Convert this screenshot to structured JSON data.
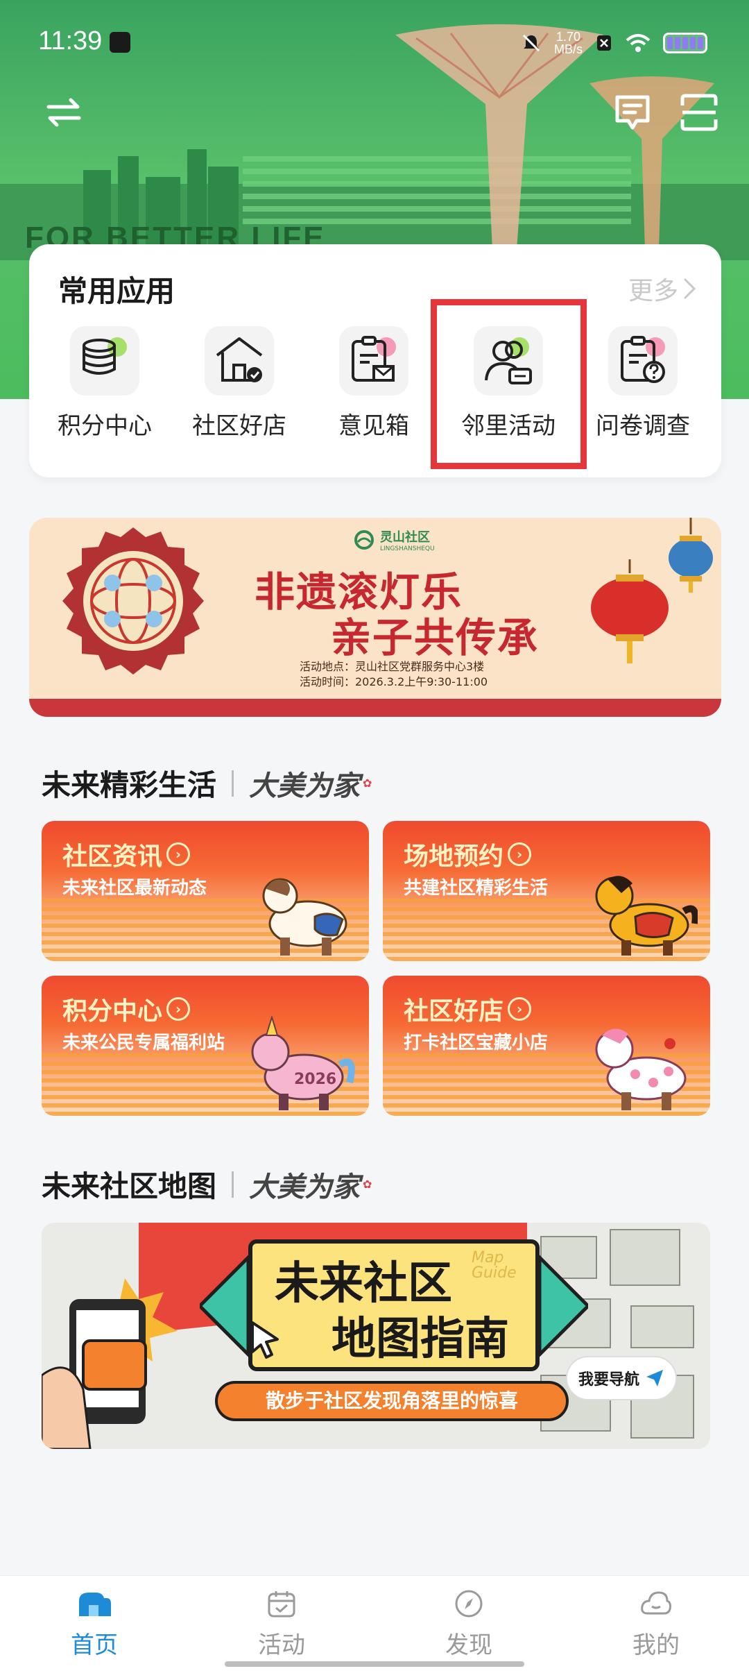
{
  "status_bar": {
    "time": "11:39",
    "net_speed_value": "1.70",
    "net_speed_unit": "MB/s"
  },
  "hero": {
    "slogan": "FOR BETTER LIFE"
  },
  "apps": {
    "title": "常用应用",
    "more": "更多",
    "items": [
      {
        "label": "积分中心",
        "icon": "coins-stack-icon",
        "accent": "#a6e06b"
      },
      {
        "label": "社区好店",
        "icon": "store-house-icon",
        "accent": "#8ec9f5"
      },
      {
        "label": "意见箱",
        "icon": "clipboard-mail-icon",
        "accent": "#f59ab7"
      },
      {
        "label": "邻里活动",
        "icon": "people-chat-icon",
        "accent": "#a6e06b"
      },
      {
        "label": "问卷调查",
        "icon": "clipboard-question-icon",
        "accent": "#f59ab7"
      }
    ]
  },
  "promo": {
    "logo": "灵山社区",
    "logo_sub": "LINGSHANSHEQU",
    "title_line1": "非遗滚灯乐",
    "title_line2": "亲子共传承",
    "location": "活动地点：灵山社区党群服务中心3楼",
    "time": "活动时间：2026.3.2上午9:30-11:00"
  },
  "section_life": {
    "title": "未来精彩生活",
    "tag": "大美为家"
  },
  "tiles": [
    {
      "title": "社区资讯",
      "sub": "未来社区最新动态"
    },
    {
      "title": "场地预约",
      "sub": "共建社区精彩生活"
    },
    {
      "title": "积分中心",
      "sub": "未来公民专属福利站",
      "horse_text": "2026"
    },
    {
      "title": "社区好店",
      "sub": "打卡社区宝藏小店"
    }
  ],
  "section_map": {
    "title": "未来社区地图",
    "tag": "大美为家"
  },
  "map": {
    "title_line1": "未来社区",
    "title_line2": "地图指南",
    "map_guide": "Map Guide",
    "subtitle": "散步于社区发现角落里的惊喜",
    "nav_button": "我要导航"
  },
  "tabbar": [
    {
      "label": "首页",
      "icon": "home-icon",
      "active": true
    },
    {
      "label": "活动",
      "icon": "calendar-icon",
      "active": false
    },
    {
      "label": "发现",
      "icon": "compass-icon",
      "active": false
    },
    {
      "label": "我的",
      "icon": "profile-cloud-icon",
      "active": false
    }
  ],
  "colors": {
    "accent_blue": "#1d8bd6",
    "highlight_red": "#e5373b",
    "promo_red": "#c7282f",
    "tile_orange": "#f04a2f"
  }
}
